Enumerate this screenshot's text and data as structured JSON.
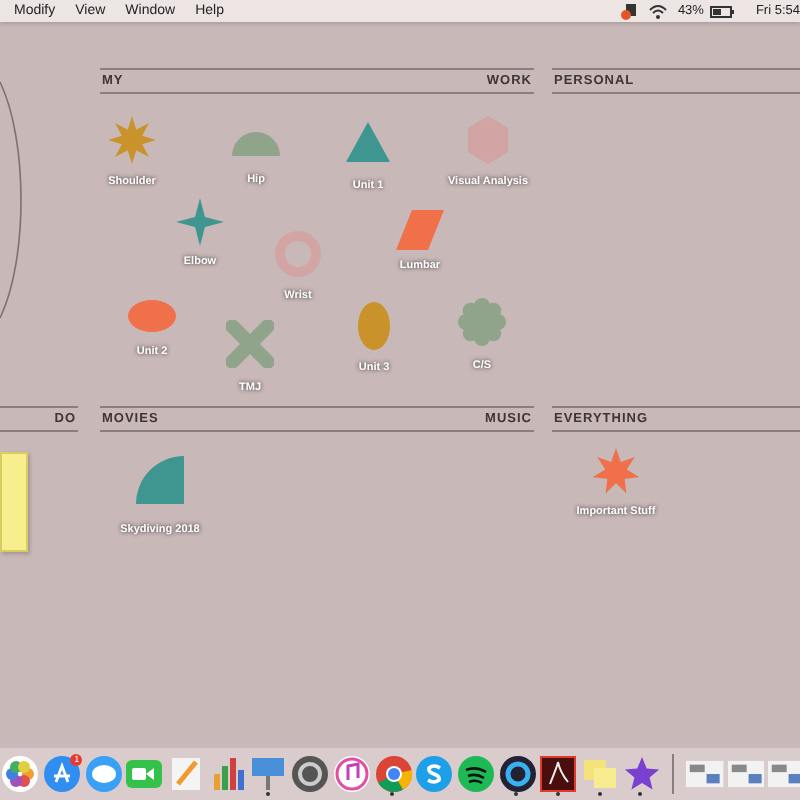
{
  "menu_bar": {
    "items": [
      "Modify",
      "View",
      "Window",
      "Help"
    ],
    "battery": "43%",
    "clock": "Fri 5:54"
  },
  "wallpaper_sections": [
    {
      "left": "MY",
      "right": "WORK"
    },
    {
      "left": "PERSONAL"
    },
    {
      "right": "DO"
    },
    {
      "left": "MOVIES",
      "right": "MUSIC"
    },
    {
      "left": "EVERYTHING"
    }
  ],
  "desktop_icons": [
    {
      "label": "Shoulder",
      "kind": "star8",
      "color": "#c9922a"
    },
    {
      "label": "Hip",
      "kind": "semicircle",
      "color": "#8fa48a"
    },
    {
      "label": "Unit 1",
      "kind": "triangle",
      "color": "#3f9590"
    },
    {
      "label": "Visual Analysis",
      "kind": "hexagon",
      "color": "#d3a4a4"
    },
    {
      "label": "Elbow",
      "kind": "star4",
      "color": "#3f9590"
    },
    {
      "label": "Wrist",
      "kind": "ring",
      "color": "#d3a4a4"
    },
    {
      "label": "Lumbar",
      "kind": "parallelogram",
      "color": "#f0704a"
    },
    {
      "label": "Unit 2",
      "kind": "ellipse",
      "color": "#f0704a"
    },
    {
      "label": "TMJ",
      "kind": "cross",
      "color": "#8fa48a"
    },
    {
      "label": "Unit 3",
      "kind": "oval",
      "color": "#c9922a"
    },
    {
      "label": "C/S",
      "kind": "flower",
      "color": "#8fa48a"
    },
    {
      "label": "Skydiving 2018",
      "kind": "quarter",
      "color": "#3f9590"
    },
    {
      "label": "Important Stuff",
      "kind": "star7",
      "color": "#f0704a"
    }
  ],
  "dock": [
    {
      "kind": "photos",
      "running": false
    },
    {
      "kind": "appstore",
      "running": false,
      "badge": "1"
    },
    {
      "kind": "messages",
      "running": false
    },
    {
      "kind": "facetime",
      "running": false
    },
    {
      "kind": "pages",
      "running": false
    },
    {
      "kind": "numbers",
      "running": false
    },
    {
      "kind": "keynote",
      "running": true
    },
    {
      "kind": "settings",
      "running": false
    },
    {
      "kind": "music",
      "running": false
    },
    {
      "kind": "chrome",
      "running": true
    },
    {
      "kind": "skype",
      "running": false
    },
    {
      "kind": "spotify",
      "running": false
    },
    {
      "kind": "quicktime",
      "running": true
    },
    {
      "kind": "acrobat",
      "running": true
    },
    {
      "kind": "stickies",
      "running": true
    },
    {
      "kind": "imovie",
      "running": true
    },
    {
      "kind": "thumbnail",
      "running": false
    },
    {
      "kind": "thumbnail",
      "running": false
    },
    {
      "kind": "thumbnail",
      "running": false
    }
  ]
}
